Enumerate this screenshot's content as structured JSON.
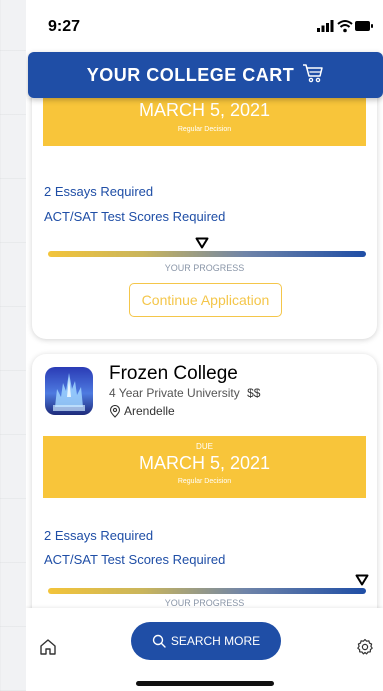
{
  "status_bar": {
    "time": "9:27"
  },
  "header": {
    "title": "YOUR COLLEGE CART",
    "icon": "shopping-cart-icon"
  },
  "cards": [
    {
      "due_date": "MARCH 5, 2021",
      "decision": "Regular Decision",
      "requirements": [
        "2 Essays Required",
        "ACT/SAT Test Scores Required"
      ],
      "progress_label": "YOUR PROGRESS",
      "progress": 0.5,
      "continue_label": "Continue Application"
    },
    {
      "name": "Frozen College",
      "type": "4 Year Private University",
      "price": "$$",
      "location": "Arendelle",
      "due_label": "DUE",
      "due_date": "MARCH 5, 2021",
      "decision": "Regular Decision",
      "requirements": [
        "2 Essays Required",
        "ACT/SAT Test Scores Required"
      ],
      "progress_label": "YOUR PROGRESS",
      "progress": 1.0
    }
  ],
  "bottom_nav": {
    "home_icon": "home-icon",
    "search_label": "SEARCH MORE",
    "settings_icon": "gear-icon"
  },
  "colors": {
    "primary": "#1f4ea6",
    "accent": "#f8c53a"
  }
}
